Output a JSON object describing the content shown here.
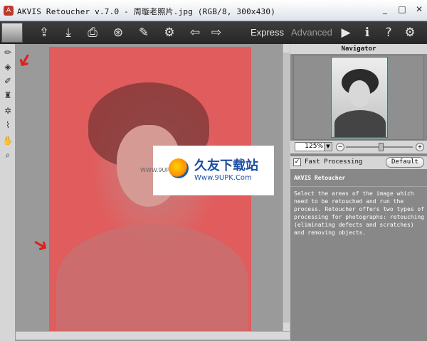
{
  "window": {
    "title": "AKVIS Retoucher v.7.0 - 周璇老照片.jpg (RGB/8, 300x430)",
    "buttons": [
      "_",
      "□",
      "✕"
    ]
  },
  "toolbar": {
    "mode_express": "Express",
    "mode_advanced": "Advanced",
    "icons": [
      "open-icon",
      "save-icon",
      "print-icon",
      "share-icon",
      "brush-icon",
      "settings-gear-icon",
      "undo-icon",
      "redo-icon"
    ]
  },
  "tools": [
    "pencil-icon",
    "eraser-icon",
    "patch-icon",
    "fill-icon",
    "magic-wand-icon",
    "dropper-icon",
    "hand-icon",
    "zoom-icon"
  ],
  "watermark": {
    "title": "久友下载站",
    "url": "Www.9UPK.Com",
    "side_text": "WWW.9UPK.COM"
  },
  "navigator": {
    "title": "Navigator",
    "zoom_value": "125%",
    "zoom_slider_fraction": 0.52
  },
  "options": {
    "fast_processing_label": "Fast Processing",
    "fast_processing_checked": true,
    "default_button": "Default"
  },
  "help": {
    "title": "AKVIS Retoucher",
    "text": "Select the areas of the image which need to be retouched and run the process. Retoucher offers two types of processing for photographs: retouching (eliminating defects and scratches) and removing objects."
  },
  "colors": {
    "toolbar_bg": "#2e2e2e",
    "mask_red": "#e15c5c",
    "panel_gray": "#888888",
    "active_mode": "#e8e8e8",
    "inactive_mode": "#9a9a9a"
  }
}
